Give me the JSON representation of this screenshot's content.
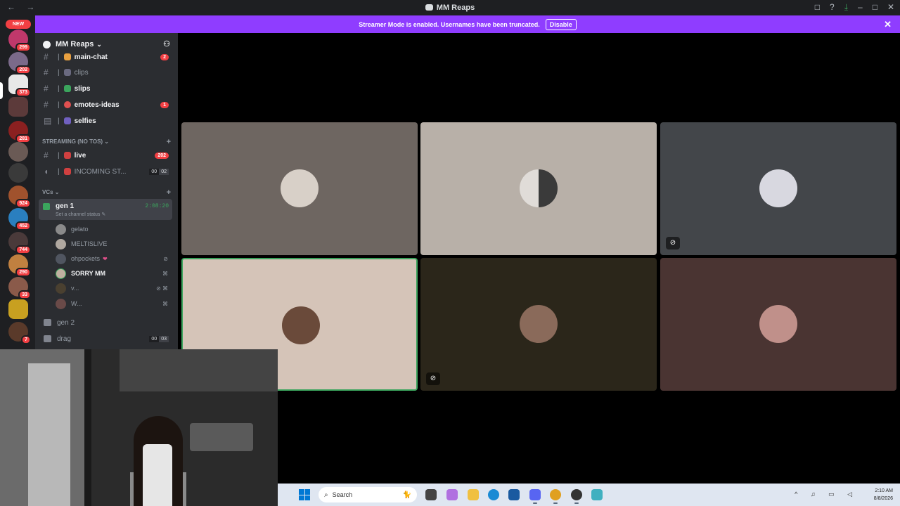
{
  "window": {
    "title": "MM Reaps",
    "nav_arrows": "← →",
    "controls": [
      "□",
      "?",
      "⤓",
      "–",
      "□",
      "✕"
    ]
  },
  "banner": {
    "text": "Streamer Mode is enabled. Usernames have been truncated.",
    "button": "Disable",
    "close": "✕"
  },
  "guilds": {
    "new_label": "NEW",
    "badges": [
      "299",
      "202",
      "373",
      "281",
      "924",
      "452",
      "744",
      "290",
      "33",
      "7"
    ]
  },
  "server": {
    "name": "MM Reaps",
    "chevron": "⌄"
  },
  "channels": [
    {
      "name": "main-chat",
      "badge": "2"
    },
    {
      "name": "clips"
    },
    {
      "name": "slips"
    },
    {
      "name": "emotes-ideas",
      "badge": "1"
    },
    {
      "name": "selfies"
    }
  ],
  "streaming_category": "STREAMING (NO TOS)",
  "streaming_channels": [
    {
      "name": "live",
      "badge": "202"
    },
    {
      "name": "INCOMING ST...",
      "count_a": "00",
      "count_b": "02"
    }
  ],
  "vcs_category": "VCs",
  "active_vc": {
    "name": "gen 1",
    "status": "Set a channel status ✎",
    "timer": "2:08:20"
  },
  "vc_users": [
    {
      "name": "gelato"
    },
    {
      "name": "MELTISLIVE"
    },
    {
      "name": "ohpockets"
    },
    {
      "name": "SORRY MM"
    },
    {
      "name": "v..."
    },
    {
      "name": "W..."
    }
  ],
  "other_vcs": [
    {
      "name": "gen 2"
    },
    {
      "name": "drag",
      "count_a": "00",
      "count_b": "03"
    }
  ],
  "tiles_colors": [
    "#6e6661",
    "#b8b0a8",
    "#43464a",
    "#d5c4b8",
    "#2b261a",
    "#4a3432"
  ],
  "taskbar": {
    "search_placeholder": "Search",
    "time": "2:10 AM",
    "date": "8/8/2026"
  }
}
